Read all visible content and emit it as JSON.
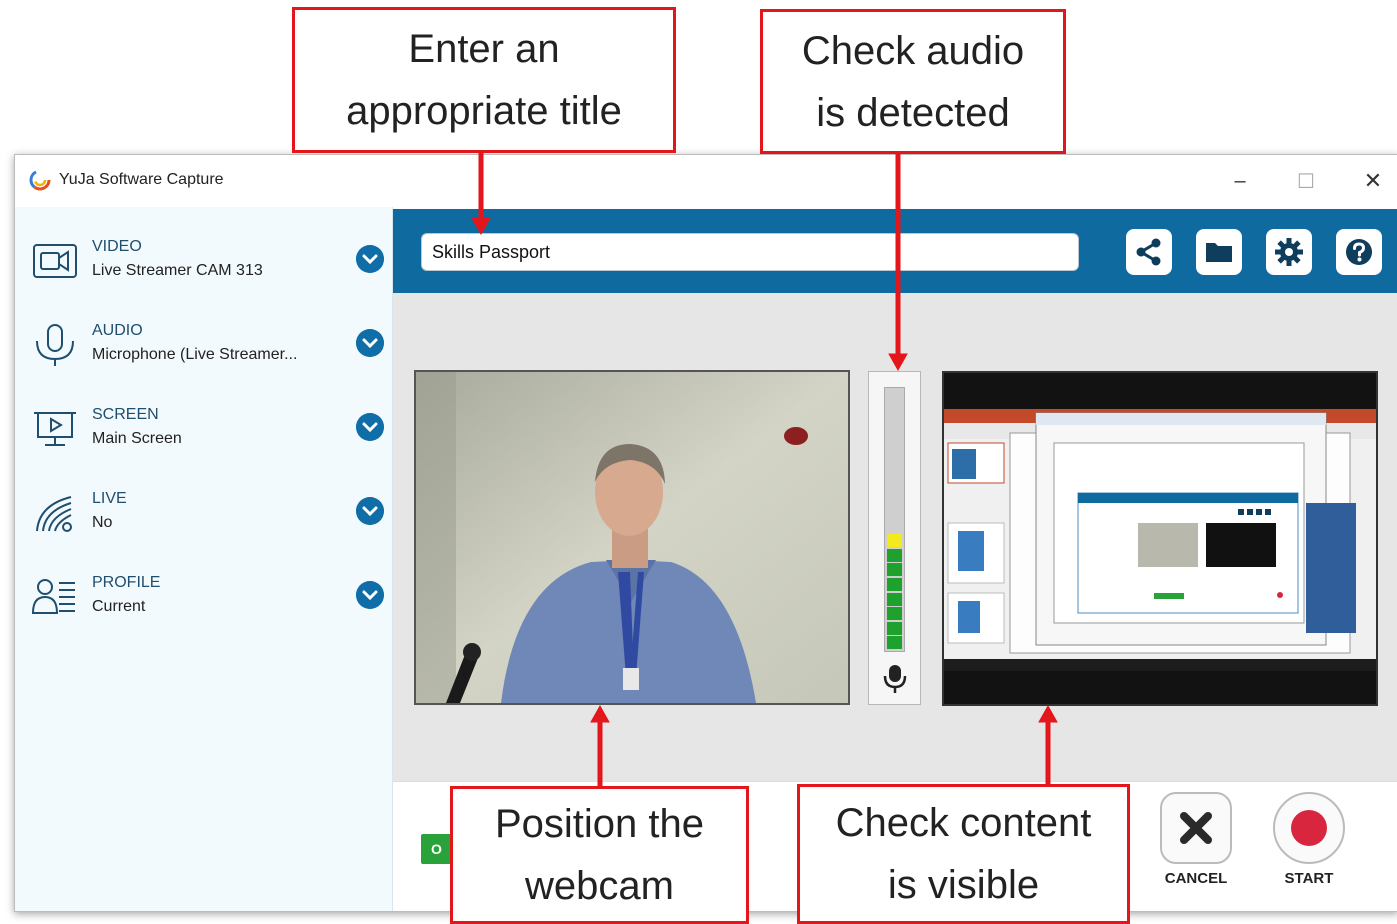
{
  "window": {
    "title": "YuJa Software Capture",
    "minimize": "–",
    "maximize": "☐",
    "close": "✕"
  },
  "sources": [
    {
      "title": "VIDEO",
      "value": "Live Streamer CAM 313",
      "icon": "video-camera-icon"
    },
    {
      "title": "AUDIO",
      "value": "Microphone (Live Streamer...",
      "icon": "microphone-icon"
    },
    {
      "title": "SCREEN",
      "value": "Main Screen",
      "icon": "screen-presentation-icon"
    },
    {
      "title": "LIVE",
      "value": "No",
      "icon": "broadcast-icon"
    },
    {
      "title": "PROFILE",
      "value": "Current",
      "icon": "profile-list-icon"
    }
  ],
  "session_title": {
    "value": "Skills Passport"
  },
  "toolbar": {
    "icons": [
      "share-icon",
      "folder-icon",
      "gear-icon",
      "help-icon"
    ]
  },
  "audio_meter": {
    "level": 0.46,
    "icon": "microphone-icon"
  },
  "actions": {
    "green_button_label": "O",
    "cancel_label": "CANCEL",
    "start_label": "START"
  },
  "colors": {
    "accent": "#0f6aa0",
    "callout_border": "#e3161b",
    "record": "#d7263d",
    "meter_green": "#1fa12e",
    "meter_yellow": "#f2ea1f"
  },
  "callouts": {
    "title": [
      "Enter an",
      "appropriate title"
    ],
    "audio": [
      "Check audio",
      "is detected"
    ],
    "webcam": [
      "Position the",
      "webcam"
    ],
    "content": [
      "Check content",
      "is visible"
    ]
  }
}
